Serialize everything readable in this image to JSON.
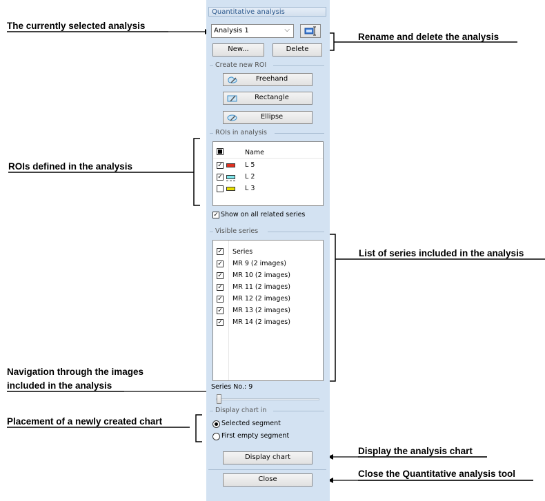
{
  "annotations": {
    "selected_analysis": "The currently selected analysis",
    "rename_delete": "Rename and delete the analysis",
    "rois_defined": "ROIs defined in the analysis",
    "series_list": "List of series included in the analysis",
    "navigation_line1": "Navigation through the images",
    "navigation_line2": "included in the analysis",
    "chart_placement": "Placement of a newly created chart",
    "display_chart": "Display the analysis chart",
    "close_tool": "Close the Quantitative analysis tool"
  },
  "panel": {
    "title": "Quantitative analysis",
    "analysis_select": {
      "value": "Analysis 1"
    },
    "buttons": {
      "new": "New...",
      "delete": "Delete"
    },
    "create_roi": {
      "title": "Create new ROI",
      "freehand": "Freehand",
      "rectangle": "Rectangle",
      "ellipse": "Ellipse"
    },
    "rois": {
      "title": "ROIs in analysis",
      "header": "Name",
      "items": [
        {
          "name": "L 5",
          "checked": true,
          "color": "#e03020"
        },
        {
          "name": "L 2",
          "checked": true,
          "color": "#7fe5ea"
        },
        {
          "name": "L 3",
          "checked": false,
          "color": "#e8e000"
        }
      ],
      "show_all_label": "Show on all related series"
    },
    "series": {
      "title": "Visible series",
      "header": "Series",
      "items": [
        "MR 9 (2 images)",
        "MR 10 (2 images)",
        "MR 11 (2 images)",
        "MR 12 (2 images)",
        "MR 13 (2 images)",
        "MR 14 (2 images)"
      ],
      "series_no_label": "Series No.: 9",
      "slider_value": 0
    },
    "display_chart_in": {
      "title": "Display chart in",
      "selected_segment": "Selected segment",
      "first_empty_segment": "First empty segment"
    },
    "display_chart_button": "Display chart",
    "close_button": "Close"
  }
}
